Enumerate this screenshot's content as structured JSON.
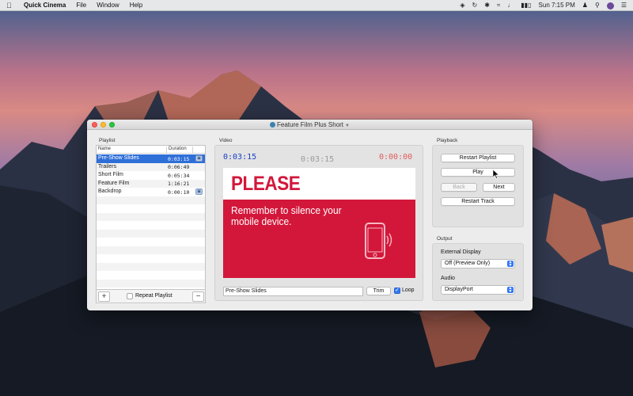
{
  "menubar": {
    "app_name": "Quick Cinema",
    "menus": [
      "File",
      "Window",
      "Help"
    ],
    "clock": "Sun 7:15 PM"
  },
  "window": {
    "title": "Feature Film Plus Short"
  },
  "playlist": {
    "section_label": "Playlist",
    "columns": {
      "name": "Name",
      "duration": "Duration"
    },
    "rows": [
      {
        "name": "Pre-Show Slides",
        "duration": "0:03:15",
        "selected": true,
        "badge": true
      },
      {
        "name": "Trailers",
        "duration": "0:06:49",
        "selected": false,
        "badge": false
      },
      {
        "name": "Short Film",
        "duration": "0:05:34",
        "selected": false,
        "badge": false
      },
      {
        "name": "Feature Film",
        "duration": "1:16:21",
        "selected": false,
        "badge": false
      },
      {
        "name": "Backdrop",
        "duration": "0:00:10",
        "selected": false,
        "badge": true
      }
    ],
    "add_label": "+",
    "remove_label": "−",
    "repeat_label": "Repeat Playlist",
    "repeat_checked": false
  },
  "video": {
    "section_label": "Video",
    "elapsed": "0:03:15",
    "total": "0:03:15",
    "remaining": "0:00:00",
    "slide": {
      "headline": "PLEASE",
      "message": "Remember to silence your mobile device."
    },
    "track_name": "Pre-Show Slides",
    "trim_label": "Trim",
    "loop_label": "Loop",
    "loop_checked": true
  },
  "playback": {
    "section_label": "Playback",
    "restart_playlist_label": "Restart Playlist",
    "play_label": "Play",
    "back_label": "Back",
    "next_label": "Next",
    "restart_track_label": "Restart Track"
  },
  "output": {
    "section_label": "Output",
    "external_display_label": "External Display",
    "external_display_value": "Off (Preview Only)",
    "audio_label": "Audio",
    "audio_value": "DisplayPort"
  },
  "colors": {
    "selection": "#2f6fd8",
    "elapsed_timecode": "#1a3fc4",
    "total_timecode": "#9a9a9a",
    "remaining_timecode": "#e25a5a",
    "slide_red": "#d3173a",
    "accent": "#3478f6"
  }
}
